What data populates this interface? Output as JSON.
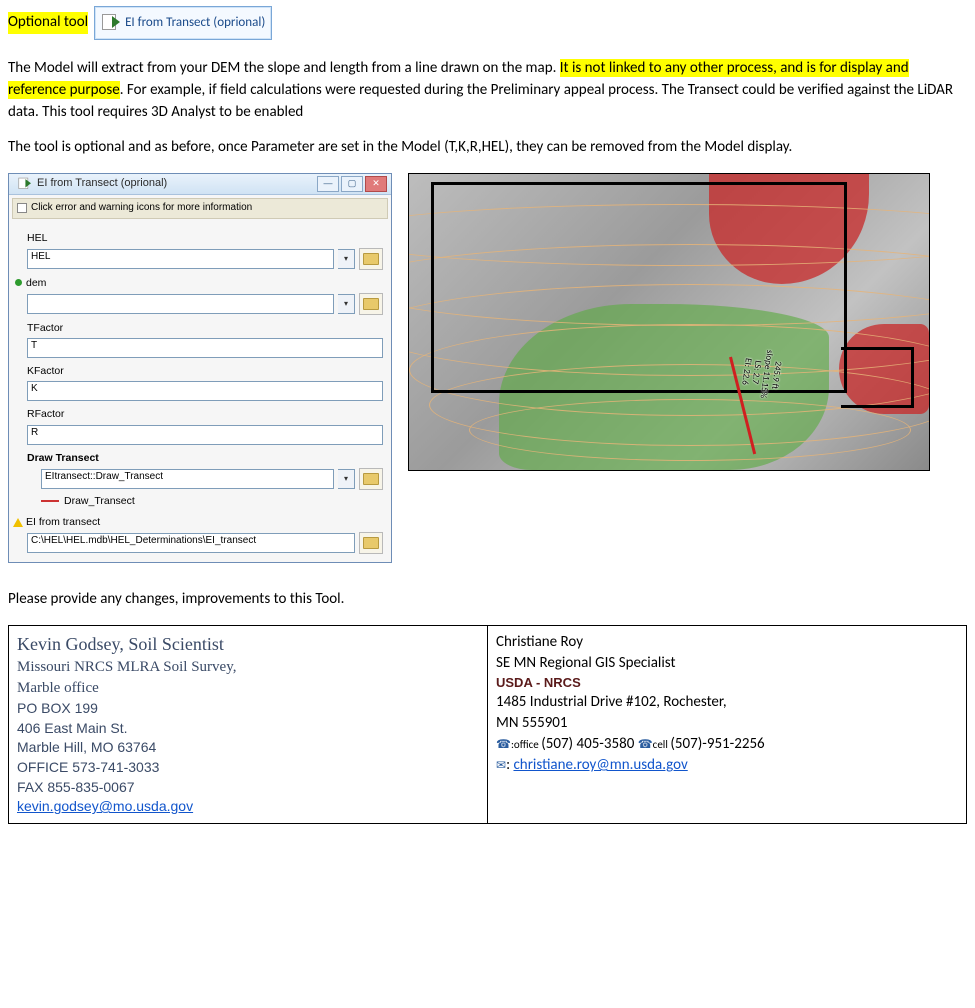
{
  "header": {
    "optional_tool_label": "Optional tool",
    "tool_button_label": "EI from Transect (oprional)"
  },
  "paragraphs": {
    "p1_pre": "The Model will extract from your DEM the slope and length from a line drawn on the map. ",
    "p1_hl": "It is not linked to any other process, and is for display and reference purpose",
    "p1_post": ". For example, if field calculations were requested during the Preliminary appeal process. The Transect could be verified against the LiDAR data. This tool requires 3D Analyst to be enabled",
    "p2": "The tool is optional and as before, once Parameter are set in the Model (T,K,R,HEL), they can be removed from the Model display.",
    "p3": "Please provide any changes, improvements to this Tool."
  },
  "dialog": {
    "title": "EI from Transect (oprional)",
    "hint": "Click error and warning icons for more information",
    "fields": {
      "hel_label": "HEL",
      "hel_value": "HEL",
      "dem_label": "dem",
      "dem_value": "",
      "t_label": "TFactor",
      "t_value": "T",
      "k_label": "KFactor",
      "k_value": "K",
      "r_label": "RFactor",
      "r_value": "R",
      "draw_label": "Draw Transect",
      "draw_value": "EItransect::Draw_Transect",
      "draw_sub": "Draw_Transect",
      "out_label": "EI from transect",
      "out_value": "C:\\HEL\\HEL.mdb\\HEL_Determinations\\EI_transect"
    }
  },
  "map": {
    "transect_label_lines": [
      "245.9 ft",
      "slope 11.15%",
      "LS: 2.7",
      "EI: 22.6"
    ]
  },
  "contacts": {
    "left": {
      "name": "Kevin Godsey, Soil Scientist",
      "org1": "Missouri NRCS MLRA Soil Survey,",
      "org2": "Marble office",
      "po": "PO BOX 199",
      "street": "406 East Main St.",
      "citystate": "Marble Hill, MO 63764",
      "office": "OFFICE 573-741-3033",
      "fax": "FAX 855-835-0067",
      "email": "kevin.godsey@mo.usda.gov"
    },
    "right": {
      "name": "Christiane  Roy",
      "title": "SE MN Regional GIS Specialist",
      "agency": "USDA - NRCS",
      "addr1": "1485 Industrial Drive #102, Rochester,",
      "addr2": "MN  555901",
      "phone_office_lbl": ":office ",
      "phone_office": "(507) 405-3580",
      "phone_cell_lbl": "cell  ",
      "phone_cell": "(507)-951-2256",
      "email_lbl": ": ",
      "email": "christiane.roy@mn.usda.gov"
    }
  }
}
